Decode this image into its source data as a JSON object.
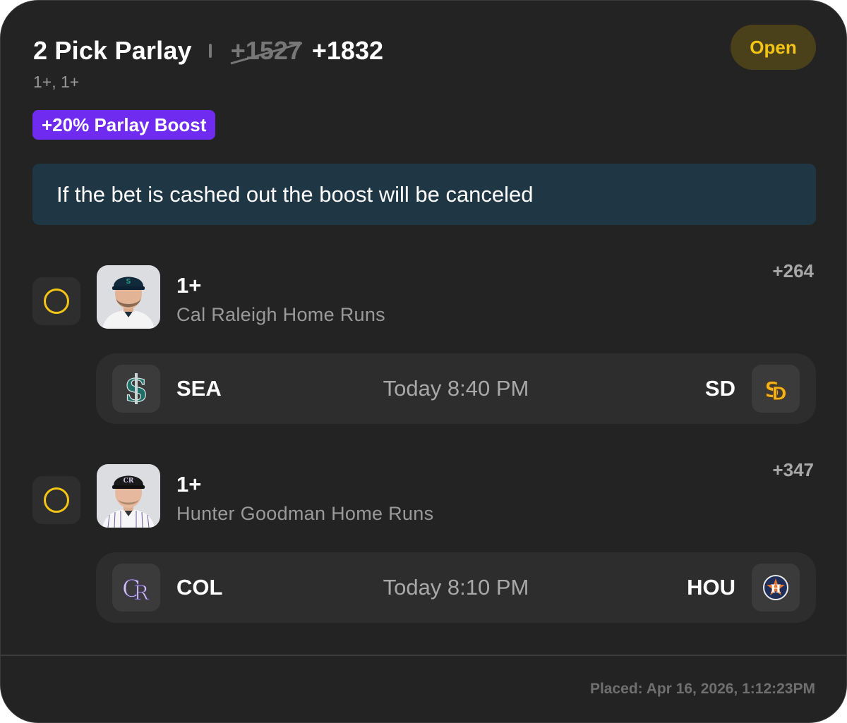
{
  "header": {
    "title": "2 Pick Parlay",
    "old_odds": "+1527",
    "new_odds": "+1832",
    "subtitle": "1+, 1+",
    "status": "Open",
    "status_color": "#f2c516"
  },
  "boost": {
    "label": "+20% Parlay Boost",
    "color": "#6f2cf0"
  },
  "notice": {
    "text": "If the bet is cashed out the boost will be canceled"
  },
  "picks": [
    {
      "line": "1+",
      "description": "Cal Raleigh Home Runs",
      "odds": "+264",
      "headshot_icon": "player-headshot-icon",
      "game": {
        "away_team": "SEA",
        "away_logo": "mariners-logo-icon",
        "time": "Today 8:40 PM",
        "home_team": "SD",
        "home_logo": "padres-logo-icon"
      }
    },
    {
      "line": "1+",
      "description": "Hunter Goodman Home Runs",
      "odds": "+347",
      "headshot_icon": "player-headshot-icon",
      "game": {
        "away_team": "COL",
        "away_logo": "rockies-logo-icon",
        "time": "Today 8:10 PM",
        "home_team": "HOU",
        "home_logo": "astros-logo-icon"
      }
    }
  ],
  "footer": {
    "placed": "Placed: Apr 16, 2026, 1:12:23PM"
  }
}
